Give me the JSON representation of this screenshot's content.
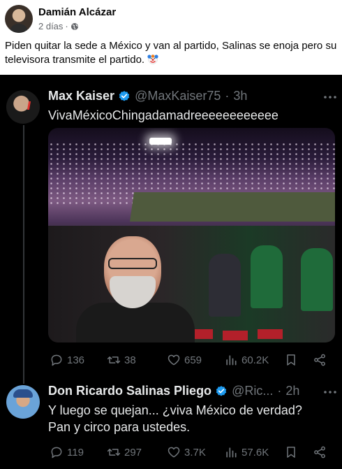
{
  "facebook_post": {
    "author": "Damián Alcázar",
    "time": "2 días",
    "separator": "·",
    "privacy_icon": "globe-icon",
    "text": "Piden quitar la sede a México y van al partido, Salinas se enoja pero su televisora transmite el partido.",
    "emoji": "clown-face-emoji"
  },
  "tweets": [
    {
      "name": "Max Kaiser",
      "handle": "@MaxKaiser75",
      "separator": "·",
      "time": "3h",
      "verified": true,
      "body": "VivaMéxicoChingadamadreeeeeeeeeeee",
      "has_photo": true,
      "stats": {
        "replies": "136",
        "retweets": "38",
        "likes": "659",
        "views": "60.2K"
      }
    },
    {
      "name": "Don Ricardo Salinas Pliego",
      "handle": "@Ric...",
      "separator": "·",
      "time": "2h",
      "verified": true,
      "body": "Y luego se quejan... ¿viva México de verdad? Pan y circo para ustedes.",
      "has_photo": false,
      "stats": {
        "replies": "119",
        "retweets": "297",
        "likes": "3.7K",
        "views": "57.6K"
      }
    }
  ],
  "colors": {
    "dark_bg": "#000000",
    "text_primary": "#e7e9ea",
    "text_secondary": "#71767b",
    "verified_blue": "#1d9bf0",
    "fb_text": "#050505",
    "fb_meta": "#65676b"
  }
}
